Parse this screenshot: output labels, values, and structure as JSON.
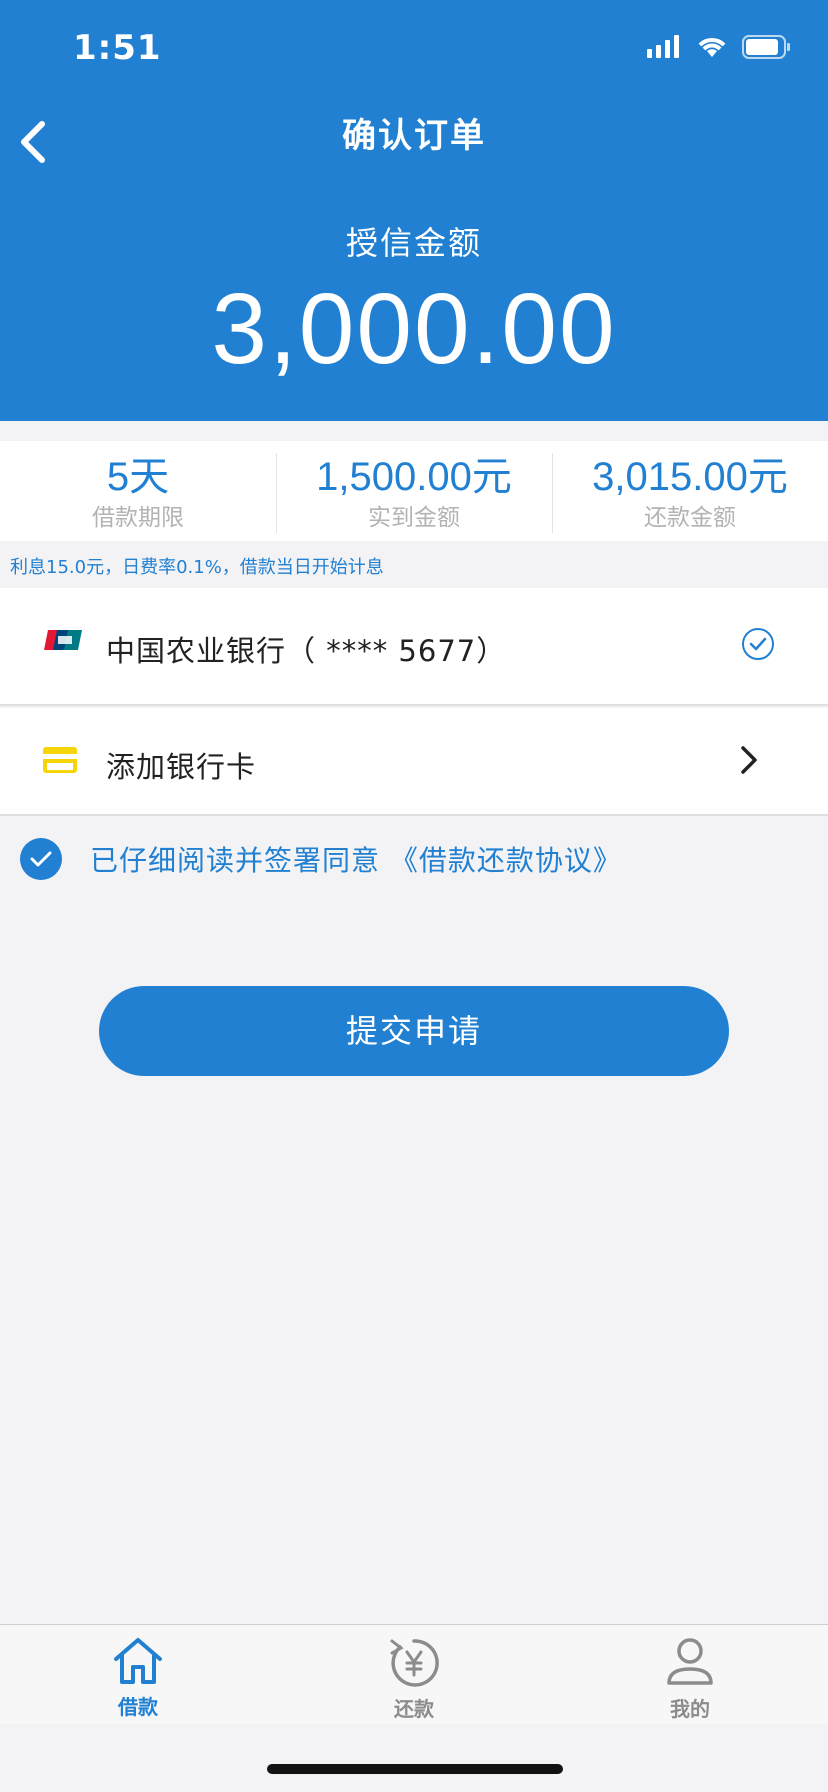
{
  "status": {
    "time": "1:51"
  },
  "nav": {
    "title": "确认订单"
  },
  "credit": {
    "label": "授信金额",
    "amount": "3,000.00"
  },
  "stats": [
    {
      "value": "5天",
      "label": "借款期限"
    },
    {
      "value": "1,500.00元",
      "label": "实到金额"
    },
    {
      "value": "3,015.00元",
      "label": "还款金额"
    }
  ],
  "interest_note": "利息15.0元，日费率0.1%，借款当日开始计息",
  "bank": {
    "name": "中国农业银行（  ****  5677）",
    "selected": true
  },
  "add_card": {
    "label": "添加银行卡"
  },
  "agreement": {
    "text": "已仔细阅读并签署同意 《借款还款协议》",
    "checked": true
  },
  "submit_label": "提交申请",
  "tabs": [
    {
      "label": "借款",
      "icon": "home-icon",
      "active": true
    },
    {
      "label": "还款",
      "icon": "yuan-refresh-icon",
      "active": false
    },
    {
      "label": "我的",
      "icon": "user-icon",
      "active": false
    }
  ],
  "colors": {
    "primary": "#2180d1",
    "card_yellow": "#f6d60b",
    "inactive": "#8c8c8c"
  }
}
